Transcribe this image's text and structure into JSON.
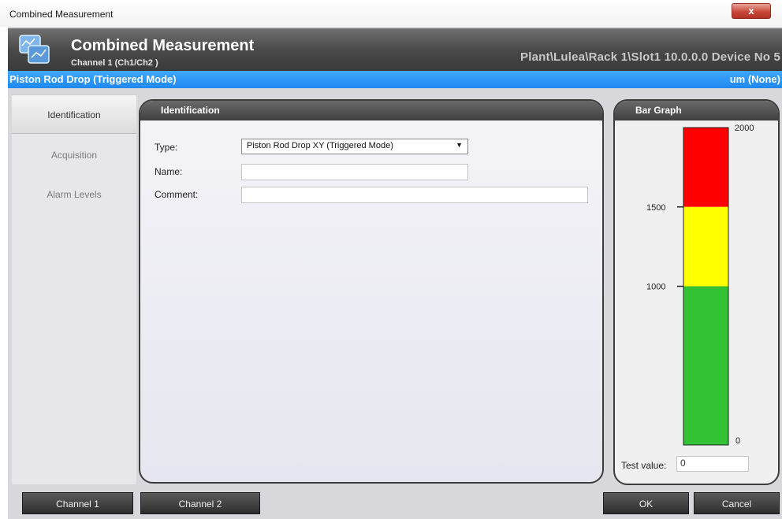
{
  "window": {
    "title": "Combined Measurement",
    "close_label": "x"
  },
  "banner": {
    "title": "Combined Measurement",
    "subtitle": "Channel 1 (Ch1/Ch2 )",
    "path": "Plant\\Lulea\\Rack 1\\Slot1 10.0.0.0 Device No 5"
  },
  "mode_bar": {
    "left": "Piston Rod Drop (Triggered Mode)",
    "right": "um (None)"
  },
  "sidebar": {
    "items": [
      {
        "label": "Identification",
        "active": true
      },
      {
        "label": "Acquisition",
        "active": false
      },
      {
        "label": "Alarm Levels",
        "active": false
      }
    ]
  },
  "identification": {
    "header": "Identification",
    "type_label": "Type:",
    "type_value": "Piston Rod Drop XY (Triggered Mode)",
    "name_label": "Name:",
    "name_value": "",
    "comment_label": "Comment:",
    "comment_value": ""
  },
  "bar_graph": {
    "header": "Bar Graph",
    "ticks": [
      "2000",
      "1500",
      "1000",
      "0"
    ],
    "min": 0,
    "max": 2000,
    "levels": [
      {
        "name": "danger",
        "from": 1500,
        "to": 2000,
        "color": "#ff0000"
      },
      {
        "name": "alert",
        "from": 1000,
        "to": 1500,
        "color": "#ffff00"
      },
      {
        "name": "normal",
        "from": 0,
        "to": 1000,
        "color": "#33c233"
      }
    ],
    "test_label": "Test value:",
    "test_value": "0"
  },
  "buttons": {
    "channel1": "Channel 1",
    "channel2": "Channel 2",
    "ok": "OK",
    "cancel": "Cancel"
  },
  "colors": {
    "accent_blue": "#1e88f0",
    "header_dark": "#3f3f3f"
  }
}
